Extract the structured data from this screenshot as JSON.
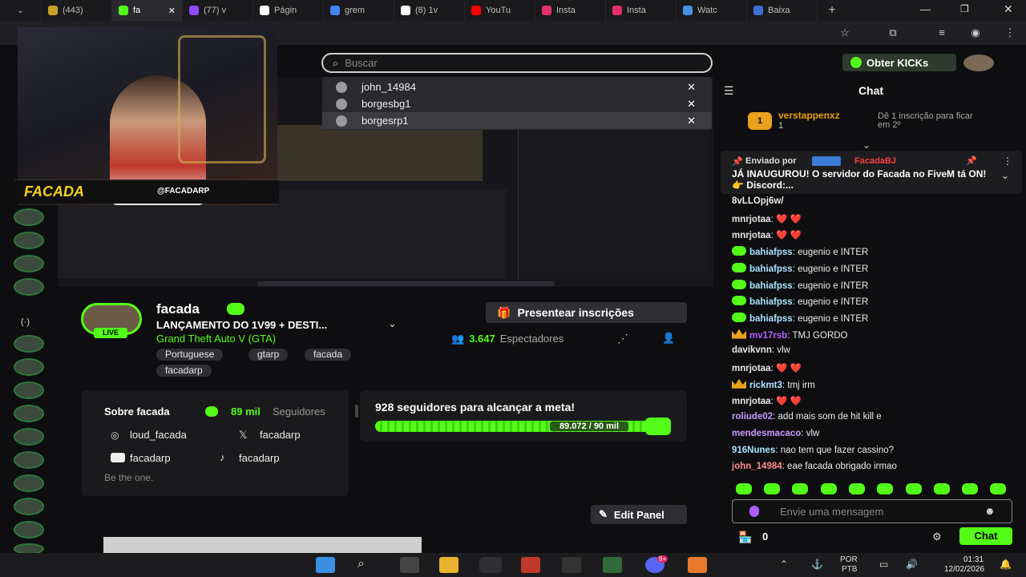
{
  "browser": {
    "tabs": [
      {
        "label": "(443)",
        "icon": "crown-icon",
        "color": "#c9a227",
        "active": false
      },
      {
        "label": "fa",
        "icon": "kick-icon",
        "color": "#53fc18",
        "active": true
      },
      {
        "label": "(77) v",
        "icon": "twitch-icon",
        "color": "#9146ff",
        "active": false
      },
      {
        "label": "Págin",
        "icon": "x-icon",
        "color": "#ffffff",
        "active": false
      },
      {
        "label": "grem",
        "icon": "google-icon",
        "color": "#4285f4",
        "active": false
      },
      {
        "label": "(8) 1v",
        "icon": "x-icon",
        "color": "#ffffff",
        "active": false
      },
      {
        "label": "YouTu",
        "icon": "youtube-icon",
        "color": "#ff0000",
        "active": false
      },
      {
        "label": "Insta",
        "icon": "instagram-icon",
        "color": "#e1306c",
        "active": false
      },
      {
        "label": "Insta",
        "icon": "instagram-icon",
        "color": "#e1306c",
        "active": false
      },
      {
        "label": "Watc",
        "icon": "watch-icon",
        "color": "#4a90e2",
        "active": false
      },
      {
        "label": "Baixa",
        "icon": "download-icon",
        "color": "#3b6fd6",
        "active": false
      }
    ]
  },
  "header": {
    "search_placeholder": "Buscar",
    "search_suggestions": [
      "john_14984",
      "borgesbg1",
      "borgesrp1"
    ],
    "obter_kicks_label": "Obter KICKs"
  },
  "stream": {
    "channel_name": "facada",
    "title": "LANÇAMENTO DO 1V99 + DESTI...",
    "game": "Grand Theft Auto V (GTA)",
    "tags": [
      "Portuguese",
      "gtarp",
      "facada",
      "facadarp"
    ],
    "live_label": "LIVE",
    "viewers_count": "3.647",
    "viewers_label": "Espectadores",
    "gift_button_label": "Presentear inscrições",
    "banner_text": "@FACADARP",
    "banner_logo": "FACADA"
  },
  "about": {
    "title": "Sobre facada",
    "followers_count": "89 mil",
    "followers_label": "Seguidores",
    "instagram": "loud_facada",
    "x": "facadarp",
    "youtube": "facadarp",
    "tiktok": "facadarp",
    "bio": "Be the one."
  },
  "goal": {
    "title": "928 seguidores para alcançar a meta!",
    "progress_text": "89.072 / 90 mil",
    "progress_fraction": 0.99
  },
  "edit_panel_label": "Edit Panel",
  "chat": {
    "title": "Chat",
    "top_gifter": {
      "name": "verstappenxz",
      "rank": "1",
      "count": "1",
      "cta": "Dê 1 inscrição para ficar em 2º"
    },
    "pinned": {
      "sent_by_label": "Enviado por",
      "sender": "FacadaBJ",
      "text": "JÁ INAUGUROU! O servidor do Facada no FiveM tá ON! 👉 Discord:..."
    },
    "messages": [
      {
        "user": "",
        "text": "8vLLOpj6w/",
        "color": "#ececec",
        "badge": "none"
      },
      {
        "user": "mnrjotaa",
        "text": "❤️ ❤️",
        "color": "#e8e8e8",
        "badge": "none"
      },
      {
        "user": "mnrjotaa",
        "text": "❤️ ❤️",
        "color": "#e8e8e8",
        "badge": "none"
      },
      {
        "user": "bahiafpss",
        "text": "eugenio e INTER",
        "color": "#a8e6ff",
        "badge": "sub"
      },
      {
        "user": "bahiafpss",
        "text": "eugenio e INTER",
        "color": "#a8e6ff",
        "badge": "sub"
      },
      {
        "user": "bahiafpss",
        "text": "eugenio e INTER",
        "color": "#a8e6ff",
        "badge": "sub"
      },
      {
        "user": "bahiafpss",
        "text": "eugenio e INTER",
        "color": "#a8e6ff",
        "badge": "sub"
      },
      {
        "user": "bahiafpss",
        "text": "eugenio e INTER",
        "color": "#a8e6ff",
        "badge": "sub"
      },
      {
        "user": "mv17rsb",
        "text": "TMJ GORDO",
        "color": "#b25dff",
        "badge": "crown"
      },
      {
        "user": "davikvnn",
        "text": "vlw",
        "color": "#e8e8e8",
        "badge": "none"
      },
      {
        "user": "mnrjotaa",
        "text": "❤️ ❤️",
        "color": "#e8e8e8",
        "badge": "none"
      },
      {
        "user": "rickmt3",
        "text": "tmj irm",
        "color": "#a8e6ff",
        "badge": "crown"
      },
      {
        "user": "mnrjotaa",
        "text": "❤️ ❤️",
        "color": "#e8e8e8",
        "badge": "none"
      },
      {
        "user": "roliude02",
        "text": "add mais som de hit kill e",
        "color": "#c89bff",
        "badge": "none"
      },
      {
        "user": "mendesmacaco",
        "text": "vlw",
        "color": "#c89bff",
        "badge": "none"
      },
      {
        "user": "916Nunes",
        "text": "nao tem que fazer cassino?",
        "color": "#a8e6ff",
        "badge": "none"
      },
      {
        "user": "john_14984",
        "text": "eae facada obrigado irmao",
        "color": "#ff8a8a",
        "badge": "none"
      }
    ],
    "input_placeholder": "Envie uma mensagem",
    "points": "0",
    "send_label": "Chat"
  },
  "taskbar": {
    "language": "POR",
    "layout": "PTB",
    "time": "01:31",
    "date": "12/02/2026",
    "discord_badge": "9+"
  }
}
